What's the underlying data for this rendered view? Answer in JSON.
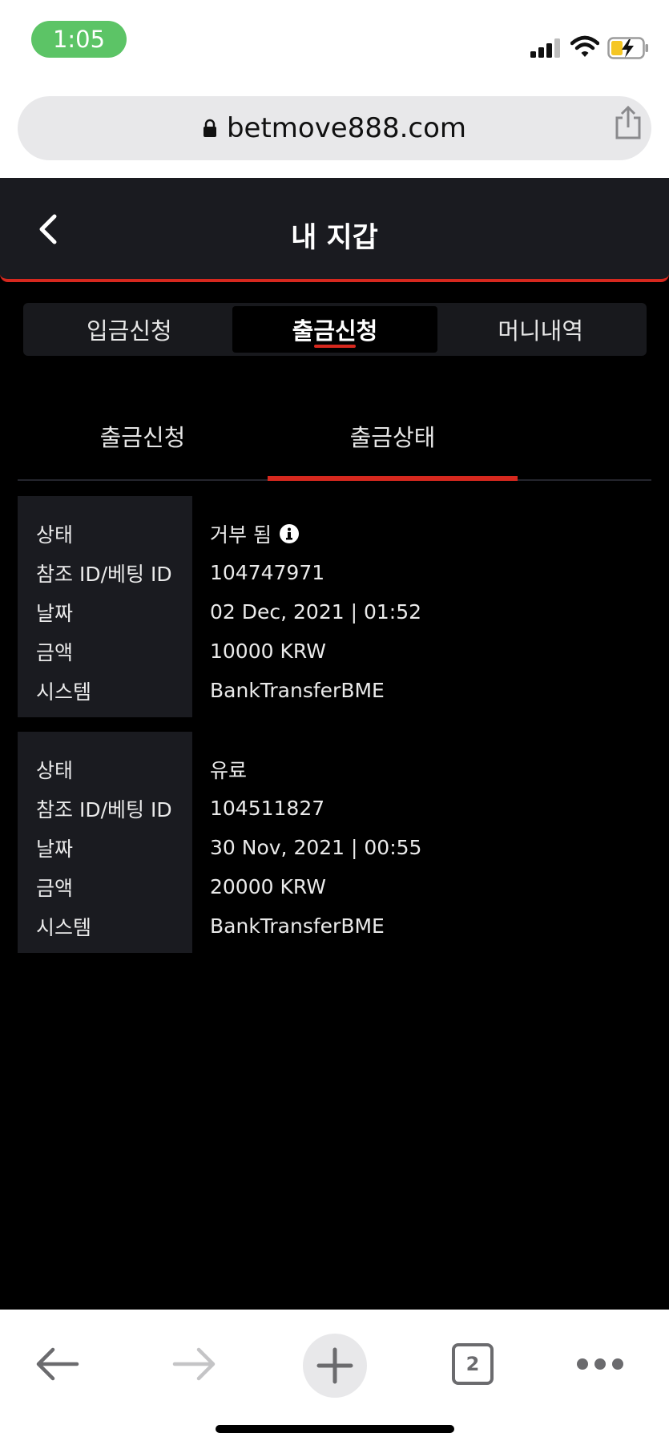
{
  "status_bar": {
    "time": "1:05"
  },
  "browser": {
    "url": "betmove888.com",
    "tab_count": "2"
  },
  "header": {
    "title": "내 지갑"
  },
  "main_tabs": [
    {
      "label": "입금신청",
      "active": false
    },
    {
      "label": "출금신청",
      "active": true
    },
    {
      "label": "머니내역",
      "active": false
    }
  ],
  "sub_tabs": [
    {
      "label": "출금신청",
      "active": false
    },
    {
      "label": "출금상태",
      "active": true
    }
  ],
  "labels": {
    "status": "상태",
    "ref_id": "참조 ID/베팅 ID",
    "date": "날짜",
    "amount": "금액",
    "system": "시스템"
  },
  "records": [
    {
      "status": "거부 됨",
      "ref_id": "104747971",
      "date": "02 Dec, 2021 | 01:52",
      "amount": "10000 KRW",
      "system": "BankTransferBME",
      "has_info": true
    },
    {
      "status": "유료",
      "ref_id": "104511827",
      "date": "30 Nov, 2021 | 00:55",
      "amount": "20000 KRW",
      "system": "BankTransferBME",
      "has_info": false
    }
  ],
  "colors": {
    "accent": "#d6281e",
    "panel": "#1a1b20",
    "time_pill": "#5cc466"
  },
  "icons": {
    "status": [
      "signal-icon",
      "wifi-icon",
      "battery-charging-icon"
    ],
    "browser": [
      "lock-icon",
      "share-icon",
      "back-arrow-icon",
      "forward-arrow-icon",
      "add-tab-icon",
      "tabs-icon",
      "more-icon"
    ],
    "header": [
      "chevron-left-icon"
    ],
    "record": [
      "info-icon"
    ]
  }
}
